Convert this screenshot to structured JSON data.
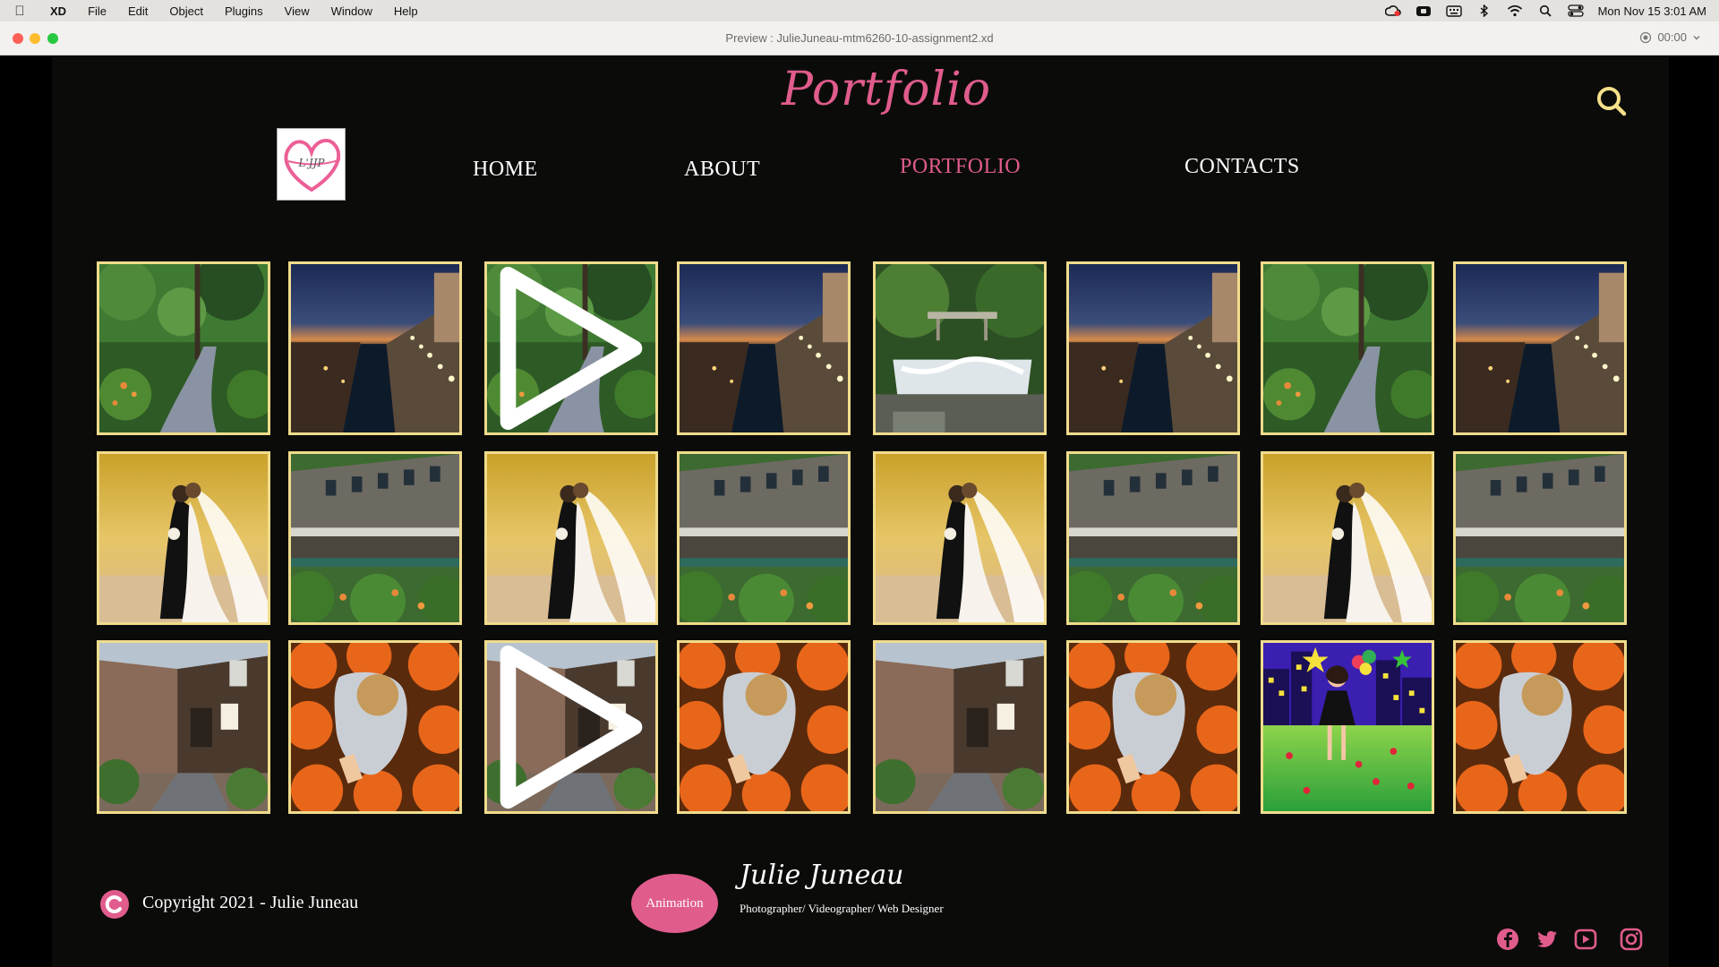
{
  "menubar": {
    "app_name": "XD",
    "items": [
      "File",
      "Edit",
      "Object",
      "Plugins",
      "View",
      "Window",
      "Help"
    ],
    "clock": "Mon Nov 15  3:01 AM"
  },
  "window": {
    "title": "Preview : JulieJuneau-mtm6260-10-assignment2.xd",
    "timer": "00:00"
  },
  "site": {
    "brand": "Portfolio",
    "logo_text": "L'JJP",
    "nav": {
      "home": "HOME",
      "about": "ABOUT",
      "portfolio": "PORTFOLIO",
      "contacts": "CONTACTS"
    },
    "active_nav": "portfolio",
    "gallery": {
      "rows": [
        [
          "garden-path",
          "canal-night",
          "garden-path",
          "canal-night",
          "waterfall",
          "canal-night",
          "garden-path",
          "canal-night"
        ],
        [
          "wedding",
          "wooden-building",
          "wedding",
          "wooden-building",
          "wedding",
          "wooden-building",
          "wedding",
          "wooden-building"
        ],
        [
          "stone-building",
          "pumpkins",
          "stone-building",
          "pumpkins",
          "stone-building",
          "pumpkins",
          "animation-girl",
          "pumpkins"
        ]
      ],
      "play_overlay_on": [
        "row1-col3",
        "row3-col3"
      ]
    },
    "footer": {
      "copyright": "Copyright 2021 - Julie Juneau",
      "animation_button": "Animation",
      "signature": "Julie Juneau",
      "tagline": "Photographer/ Videographer/ Web Designer"
    },
    "social_icons": [
      "facebook-icon",
      "twitter-icon",
      "youtube-icon",
      "instagram-icon"
    ]
  },
  "colors": {
    "accent_pink": "#e05c8c",
    "tile_border": "#f0dc8c",
    "background": "#0b0c0a",
    "search_icon": "#f6e08a"
  }
}
